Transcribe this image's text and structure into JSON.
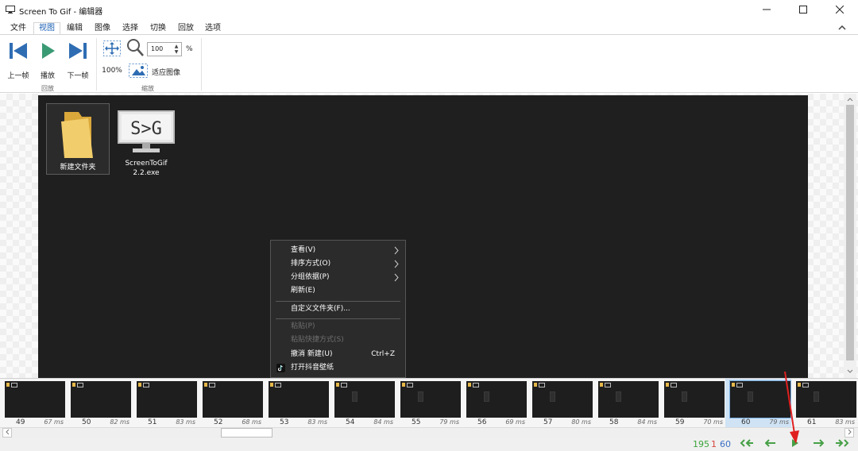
{
  "window": {
    "title": "Screen To Gif - 编辑器",
    "controls": {
      "minimize": "minimize-icon",
      "maximize": "maximize-icon",
      "close": "close-icon"
    }
  },
  "tabs": [
    {
      "label": "文件",
      "active": false
    },
    {
      "label": "视图",
      "active": true
    },
    {
      "label": "编辑",
      "active": false
    },
    {
      "label": "图像",
      "active": false
    },
    {
      "label": "选择",
      "active": false
    },
    {
      "label": "切换",
      "active": false
    },
    {
      "label": "回放",
      "active": false
    },
    {
      "label": "选项",
      "active": false
    }
  ],
  "ribbon": {
    "playback": {
      "group_label": "回放",
      "prev_label": "上一帧",
      "play_label": "播放",
      "next_label": "下一帧"
    },
    "zoom": {
      "group_label": "缩放",
      "value": "100",
      "percent_sign": "%",
      "reset_label": "100%",
      "fit_label": "适应图像"
    }
  },
  "preview": {
    "desktop_items": [
      {
        "label": "新建文件夹",
        "icon": "folder-icon"
      },
      {
        "label_line1": "ScreenToGif",
        "label_line2": "2.2.exe",
        "icon": "screentogif-monitor-icon",
        "logo_text": "S>G"
      }
    ],
    "context_menu": {
      "items": [
        {
          "label": "查看(V)",
          "submenu": true
        },
        {
          "label": "排序方式(O)",
          "submenu": true
        },
        {
          "label": "分组依据(P)",
          "submenu": true
        },
        {
          "label": "刷新(E)"
        },
        {
          "label": "自定义文件夹(F)..."
        },
        {
          "label": "粘贴(P)",
          "disabled": true
        },
        {
          "label": "粘贴快捷方式(S)",
          "disabled": true
        },
        {
          "label": "撤消 新建(U)",
          "shortcut": "Ctrl+Z"
        },
        {
          "label": "打开抖音壁纸",
          "icon": "tiktok-icon"
        }
      ]
    }
  },
  "timeline": {
    "frames": [
      {
        "number": "49",
        "delay": "67 ms"
      },
      {
        "number": "50",
        "delay": "82 ms"
      },
      {
        "number": "51",
        "delay": "83 ms"
      },
      {
        "number": "52",
        "delay": "68 ms"
      },
      {
        "number": "53",
        "delay": "83 ms"
      },
      {
        "number": "54",
        "delay": "84 ms"
      },
      {
        "number": "55",
        "delay": "79 ms"
      },
      {
        "number": "56",
        "delay": "69 ms"
      },
      {
        "number": "57",
        "delay": "80 ms"
      },
      {
        "number": "58",
        "delay": "84 ms"
      },
      {
        "number": "59",
        "delay": "70 ms"
      },
      {
        "number": "60",
        "delay": "79 ms",
        "selected": true
      },
      {
        "number": "61",
        "delay": "83 ms"
      }
    ]
  },
  "status": {
    "total_frames": "195",
    "selected_count": "1",
    "current_frame": "60"
  },
  "colors": {
    "accent_blue": "#3b6fc4",
    "total_green": "#3aa53a",
    "selected_red": "#d4453e",
    "nav_green": "#46a046",
    "annotation_red": "#e02020"
  }
}
